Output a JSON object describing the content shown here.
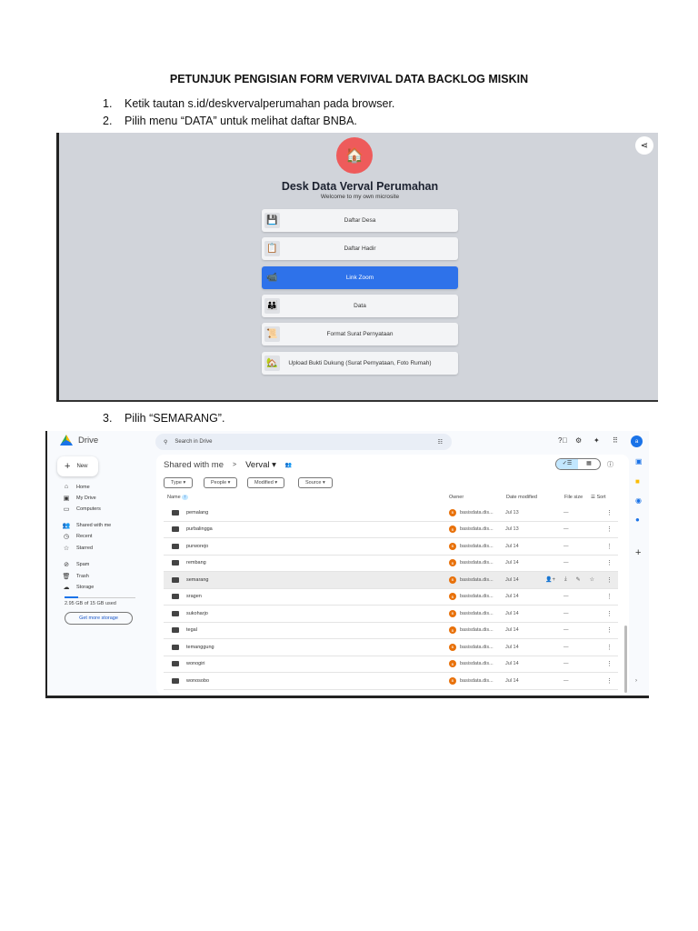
{
  "document": {
    "title": "PETUNJUK PENGISIAN FORM VERVIVAL DATA BACKLOG MISKIN",
    "steps": [
      {
        "num": "1.",
        "text": "Ketik tautan s.id/deskvervalperumahan pada browser."
      },
      {
        "num": "2.",
        "text": "Pilih menu “DATA” untuk melihat daftar BNBA."
      },
      {
        "num": "3.",
        "text": "Pilih “SEMARANG”."
      }
    ]
  },
  "microsite": {
    "title": "Desk Data Verval Perumahan",
    "subtitle": "Welcome to my own microsite",
    "accent": "#ee5b5b",
    "active_color": "#2e72ea",
    "buttons": [
      {
        "label": "Daftar Desa",
        "icon": "floppy-disk-icon",
        "glyph": "💾"
      },
      {
        "label": "Daftar Hadir",
        "icon": "clipboard-icon",
        "glyph": "📋"
      },
      {
        "label": "Link Zoom",
        "icon": "video-camera-icon",
        "glyph": "📹",
        "active": true
      },
      {
        "label": "Data",
        "icon": "people-icon",
        "glyph": "👪"
      },
      {
        "label": "Format Surat Pernyataan",
        "icon": "scroll-icon",
        "glyph": "📜"
      },
      {
        "label": "Upload Bukti Dukung (Surat Pernyataan, Foto Rumah)",
        "icon": "house-icon",
        "glyph": "🏡"
      }
    ]
  },
  "drive": {
    "app_name": "Drive",
    "search_placeholder": "Search in Drive",
    "new_label": "New",
    "nav": [
      {
        "label": "Home",
        "icon": "⌂"
      },
      {
        "label": "My Drive",
        "icon": "▣"
      },
      {
        "label": "Computers",
        "icon": "▭"
      },
      {
        "label": "Shared with me",
        "icon": "👥"
      },
      {
        "label": "Recent",
        "icon": "◷"
      },
      {
        "label": "Starred",
        "icon": "☆"
      },
      {
        "label": "Spam",
        "icon": "⊘"
      },
      {
        "label": "Trash",
        "icon": "🗑"
      },
      {
        "label": "Storage",
        "icon": "☁"
      }
    ],
    "storage_used": "2.95 GB of 15 GB used",
    "storage_fraction": 0.197,
    "get_storage": "Get more storage",
    "breadcrumb": {
      "parent": "Shared with me",
      "sep": ">",
      "current": "Verval ▾",
      "people_icon": "👥"
    },
    "filters": [
      "Type ▾",
      "People ▾",
      "Modified ▾",
      "Source ▾"
    ],
    "columns": {
      "name": "Name",
      "owner": "Owner",
      "date": "Date modified",
      "size": "File size",
      "sort": "Sort"
    },
    "rows": [
      {
        "name": "pemalang",
        "owner": "basisdata.dis...",
        "date": "Jul 13",
        "size": "—"
      },
      {
        "name": "purbalingga",
        "owner": "basisdata.dis...",
        "date": "Jul 13",
        "size": "—"
      },
      {
        "name": "purworejo",
        "owner": "basisdata.dis...",
        "date": "Jul 14",
        "size": "—"
      },
      {
        "name": "rembang",
        "owner": "basisdata.dis...",
        "date": "Jul 14",
        "size": "—"
      },
      {
        "name": "semarang",
        "owner": "basisdata.dis...",
        "date": "Jul 14",
        "size": "",
        "selected": true
      },
      {
        "name": "sragen",
        "owner": "basisdata.dis...",
        "date": "Jul 14",
        "size": "—"
      },
      {
        "name": "sukoharjo",
        "owner": "basisdata.dis...",
        "date": "Jul 14",
        "size": "—"
      },
      {
        "name": "tegal",
        "owner": "basisdata.dis...",
        "date": "Jul 14",
        "size": "—"
      },
      {
        "name": "temanggung",
        "owner": "basisdata.dis...",
        "date": "Jul 14",
        "size": "—"
      },
      {
        "name": "wonogiri",
        "owner": "basisdata.dis...",
        "date": "Jul 14",
        "size": "—"
      },
      {
        "name": "wonosobo",
        "owner": "basisdata.dis...",
        "date": "Jul 14",
        "size": "—"
      }
    ],
    "owner_initial": "B",
    "avatar_initial": "a",
    "owner_color": "#e8710a"
  }
}
